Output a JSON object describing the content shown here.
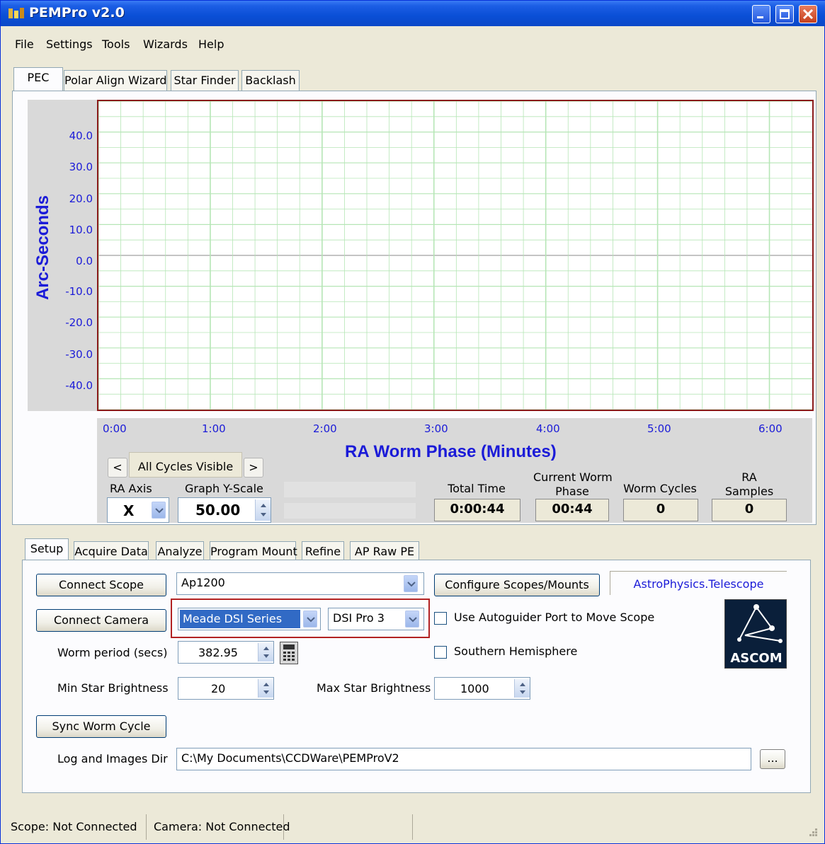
{
  "window": {
    "title": "PEMPro v2.0"
  },
  "menu": [
    "File",
    "Settings",
    "Tools",
    "Wizards",
    "Help"
  ],
  "top_tabs": [
    "PEC",
    "Polar Align Wizard",
    "Star Finder",
    "Backlash"
  ],
  "chart_data": {
    "type": "line",
    "ylabel": "Arc-Seconds",
    "xlabel": "RA Worm Phase (Minutes)",
    "y_ticks": [
      "40.0",
      "30.0",
      "20.0",
      "10.0",
      "0.0",
      "-10.0",
      "-20.0",
      "-30.0",
      "-40.0"
    ],
    "x_ticks": [
      "0:00",
      "1:00",
      "2:00",
      "3:00",
      "4:00",
      "5:00",
      "6:00"
    ],
    "ylim": [
      -50,
      50
    ],
    "xlim": [
      0,
      6.383
    ],
    "grid": true,
    "series": []
  },
  "controls": {
    "prev": "<",
    "next": ">",
    "cycles": "All Cycles Visible",
    "ra_axis_label": "RA Axis",
    "ra_axis_value": "X",
    "graph_scale_label": "Graph Y-Scale",
    "graph_scale_value": "50.00",
    "total_time_label": "Total Time",
    "total_time_value": "0:00:44",
    "worm_phase_label_1": "Current Worm",
    "worm_phase_label_2": "Phase",
    "worm_phase_value": "00:44",
    "worm_cycles_label": "Worm Cycles",
    "worm_cycles_value": "0",
    "ra_samples_label_1": "RA",
    "ra_samples_label_2": "Samples",
    "ra_samples_value": "0"
  },
  "lower_tabs": [
    "Setup",
    "Acquire Data",
    "Analyze",
    "Program Mount",
    "Refine",
    "AP Raw PE"
  ],
  "setup": {
    "connect_scope": "Connect Scope",
    "scope_value": "Ap1200",
    "configure": "Configure Scopes/Mounts",
    "driver": "AstroPhysics.Telescope",
    "connect_camera": "Connect Camera",
    "camera_value": "Meade DSI Series",
    "camera_model": "DSI Pro 3",
    "autoguider_label": "Use Autoguider Port to Move Scope",
    "worm_period_label": "Worm period (secs)",
    "worm_period_value": "382.95",
    "southern_label": "Southern Hemisphere",
    "min_star_label": "Min Star Brightness",
    "min_star_value": "20",
    "max_star_label": "Max Star Brightness",
    "max_star_value": "1000",
    "sync_worm": "Sync Worm Cycle",
    "log_dir_label": "Log and Images Dir",
    "log_dir_value": "C:\\My Documents\\CCDWare\\PEMProV2",
    "browse": "...",
    "ascom_text": "ASCOM"
  },
  "status": {
    "scope": "Scope: Not Connected",
    "camera": "Camera: Not Connected"
  },
  "colors": {
    "grid": "#b6e6b6",
    "plot_border": "#8b1a1a",
    "axis_text": "#1b1bd8",
    "camera_highlight": "#316ac5"
  }
}
